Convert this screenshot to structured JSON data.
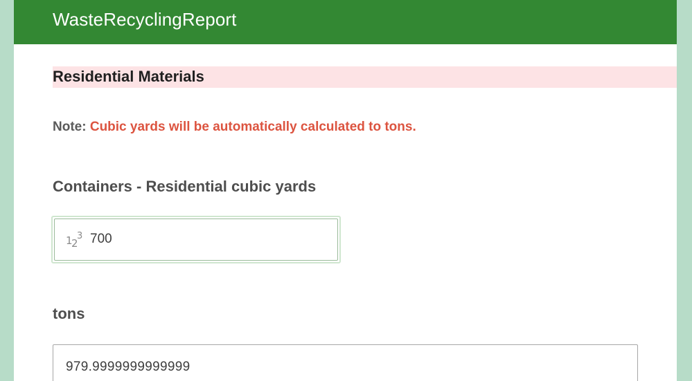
{
  "header": {
    "title": "WasteRecyclingReport"
  },
  "group": {
    "title": "Residential Materials"
  },
  "note": {
    "label": "Note:",
    "text": "Cubic yards will be automatically calculated to tons."
  },
  "fields": {
    "containers_cubic_yards": {
      "label": "Containers - Residential cubic yards",
      "icon": "numeric-123-icon",
      "value": "700"
    },
    "tons": {
      "label": "tons",
      "value": "979.9999999999999"
    }
  },
  "colors": {
    "header_bg": "#338833",
    "page_bg": "#b7dcc8",
    "group_bar_bg": "#fde3e5",
    "note_text": "#dc5440"
  }
}
